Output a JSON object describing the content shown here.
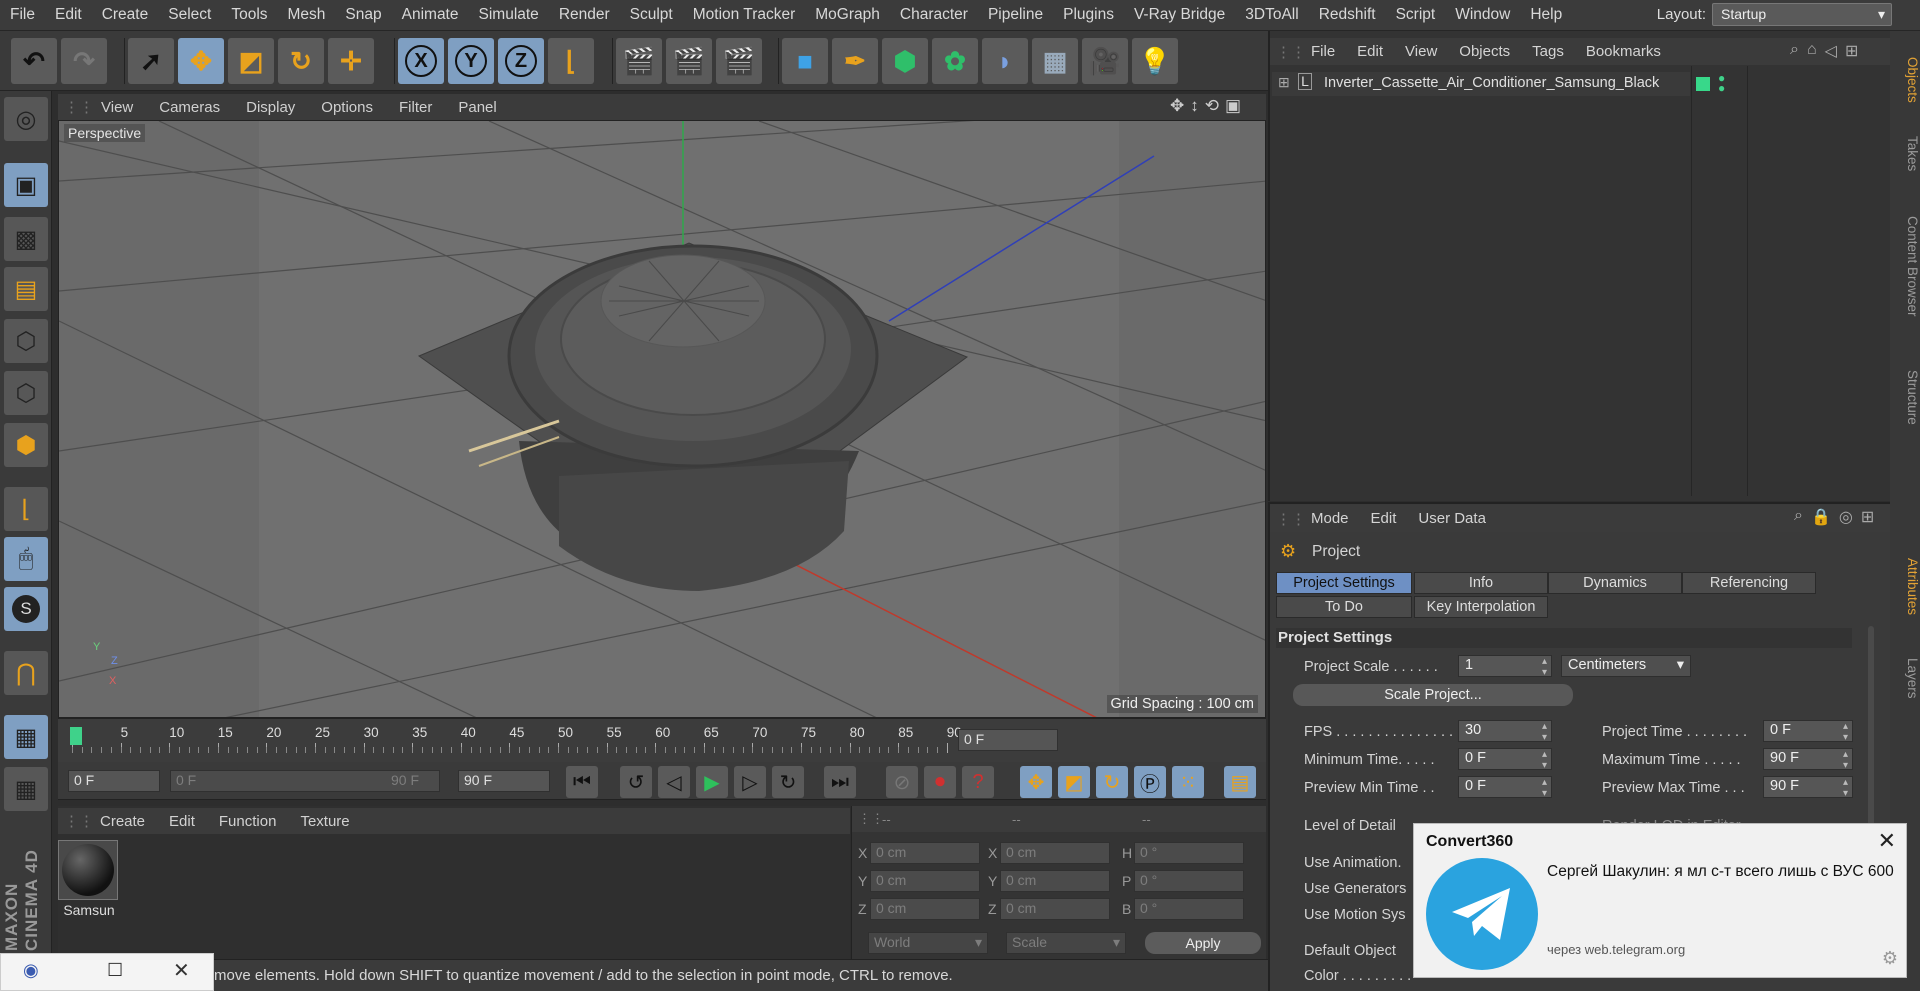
{
  "menubar": {
    "items": [
      "File",
      "Edit",
      "Create",
      "Select",
      "Tools",
      "Mesh",
      "Snap",
      "Animate",
      "Simulate",
      "Render",
      "Sculpt",
      "Motion Tracker",
      "MoGraph",
      "Character",
      "Pipeline",
      "Plugins",
      "V-Ray Bridge",
      "3DToAll",
      "Redshift",
      "Script",
      "Window",
      "Help"
    ],
    "layout_label": "Layout:",
    "layout_value": "Startup"
  },
  "toolbar": {
    "undo": "undo-icon",
    "redo": "redo-icon",
    "axis_x": "X",
    "axis_y": "Y",
    "axis_z": "Z"
  },
  "viewport": {
    "menu": [
      "View",
      "Cameras",
      "Display",
      "Options",
      "Filter",
      "Panel"
    ],
    "camera_label": "Perspective",
    "grid_spacing": "Grid Spacing : 100 cm",
    "axis_y": "Y",
    "axis_z": "Z",
    "axis_x": "X"
  },
  "timeline": {
    "ticks": [
      "0",
      "5",
      "10",
      "15",
      "20",
      "25",
      "30",
      "35",
      "40",
      "45",
      "50",
      "55",
      "60",
      "65",
      "70",
      "75",
      "80",
      "85",
      "90"
    ],
    "current_frame": "0 F"
  },
  "transport": {
    "start": "0 F",
    "range_min": "0 F",
    "range_max": "90 F",
    "end": "90 F"
  },
  "material_manager": {
    "menu": [
      "Create",
      "Edit",
      "Function",
      "Texture"
    ],
    "material_name": "Samsun"
  },
  "coordinates": {
    "headers": [
      "--",
      "--",
      "--"
    ],
    "rows": [
      {
        "a": "X",
        "av": "0 cm",
        "b": "X",
        "bv": "0 cm",
        "c": "H",
        "cv": "0 °"
      },
      {
        "a": "Y",
        "av": "0 cm",
        "b": "Y",
        "bv": "0 cm",
        "c": "P",
        "cv": "0 °"
      },
      {
        "a": "Z",
        "av": "0 cm",
        "b": "Z",
        "bv": "0 cm",
        "c": "B",
        "cv": "0 °"
      }
    ],
    "mode1": "World",
    "mode2": "Scale",
    "apply": "Apply"
  },
  "status_text": "move elements. Hold down SHIFT to quantize movement / add to the selection in point mode, CTRL to remove.",
  "object_manager": {
    "menu": [
      "File",
      "Edit",
      "View",
      "Objects",
      "Tags",
      "Bookmarks"
    ],
    "object_name": "Inverter_Cassette_Air_Conditioner_Samsung_Black"
  },
  "attribute_manager": {
    "menu": [
      "Mode",
      "Edit",
      "User Data"
    ],
    "title": "Project",
    "tabs_row1": [
      "Project Settings",
      "Info",
      "Dynamics",
      "Referencing"
    ],
    "tabs_row2": [
      "To Do",
      "Key Interpolation"
    ],
    "section": "Project Settings",
    "project_scale_label": "Project Scale . . . . . .",
    "project_scale_value": "1",
    "project_scale_unit": "Centimeters",
    "scale_project_btn": "Scale Project...",
    "fps_label": "FPS . . . . . . . . . . . . . . .",
    "fps_value": "30",
    "project_time_label": "Project Time . . . . . . . .",
    "project_time_value": "0 F",
    "min_time_label": "Minimum Time. . . . .",
    "min_time_value": "0 F",
    "max_time_label": "Maximum Time . . . . .",
    "max_time_value": "90 F",
    "preview_min_label": "Preview Min Time . .",
    "preview_min_value": "0 F",
    "preview_max_label": "Preview Max Time . . .",
    "preview_max_value": "90 F",
    "lod_label": "Level of Detail",
    "render_lod_label": "Render LOD in Editor",
    "use_animation": "Use Animation.",
    "use_generators": "Use Generators",
    "use_motion": "Use Motion Sys",
    "default_object": "Default Object",
    "color_label": "Color . . . . . . . . ."
  },
  "right_tabs": [
    "Objects",
    "Takes",
    "Content Browser",
    "Structure",
    "Attributes",
    "Layers"
  ],
  "notification": {
    "app": "Convert360",
    "message": "Сергей Шакулин: я мл с-т всего лишь с ВУС 600",
    "via": "через web.telegram.org"
  },
  "logo_text": "MAXON CINEMA 4D",
  "colors": {
    "accent": "#7f9fc2",
    "tab_active": "#6e90c4",
    "orange": "#e2a235",
    "telegram": "#2aa3df"
  }
}
